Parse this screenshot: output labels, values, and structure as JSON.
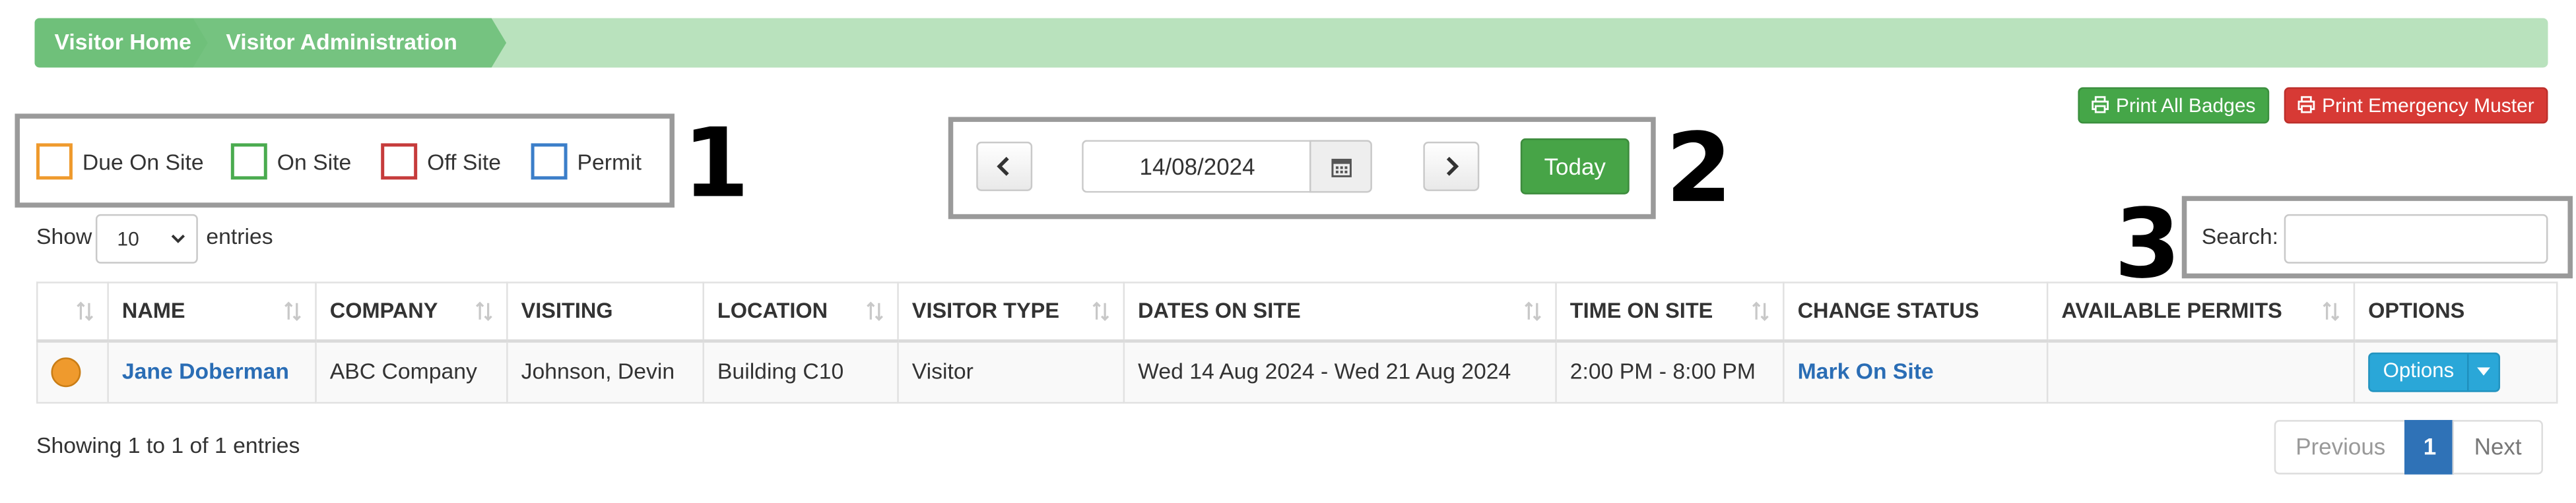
{
  "breadcrumb": {
    "items": [
      "Visitor Home",
      "Visitor Administration"
    ]
  },
  "actions": {
    "print_badges": "Print All Badges",
    "print_muster": "Print Emergency Muster"
  },
  "legend": [
    {
      "label": "Due On Site",
      "color": "#ef9a2d"
    },
    {
      "label": "On Site",
      "color": "#4aab4f"
    },
    {
      "label": "Off Site",
      "color": "#c63b3b"
    },
    {
      "label": "Permit",
      "color": "#3b7ec9"
    }
  ],
  "annotations": {
    "one": "1",
    "two": "2",
    "three": "3"
  },
  "date_nav": {
    "date": "14/08/2024",
    "today_label": "Today"
  },
  "entries": {
    "show_label": "Show",
    "selected": "10",
    "suffix": "entries"
  },
  "search": {
    "label": "Search:",
    "placeholder": ""
  },
  "table": {
    "headers": [
      "",
      "NAME",
      "COMPANY",
      "VISITING",
      "LOCATION",
      "VISITOR TYPE",
      "DATES ON SITE",
      "TIME ON SITE",
      "CHANGE STATUS",
      "AVAILABLE PERMITS",
      "OPTIONS"
    ],
    "rows": [
      {
        "status_color": "#ef9a2d",
        "name": "Jane Doberman",
        "company": "ABC Company",
        "visiting": "Johnson, Devin",
        "location": "Building C10",
        "visitor_type": "Visitor",
        "dates_on_site": "Wed 14 Aug 2024 - Wed 21 Aug 2024",
        "time_on_site": "2:00 PM - 8:00 PM",
        "change_status": "Mark On Site",
        "available_permits": "",
        "options_label": "Options"
      }
    ]
  },
  "footer": {
    "info": "Showing 1 to 1 of 1 entries",
    "pagination": {
      "previous": "Previous",
      "current": "1",
      "next": "Next"
    }
  }
}
